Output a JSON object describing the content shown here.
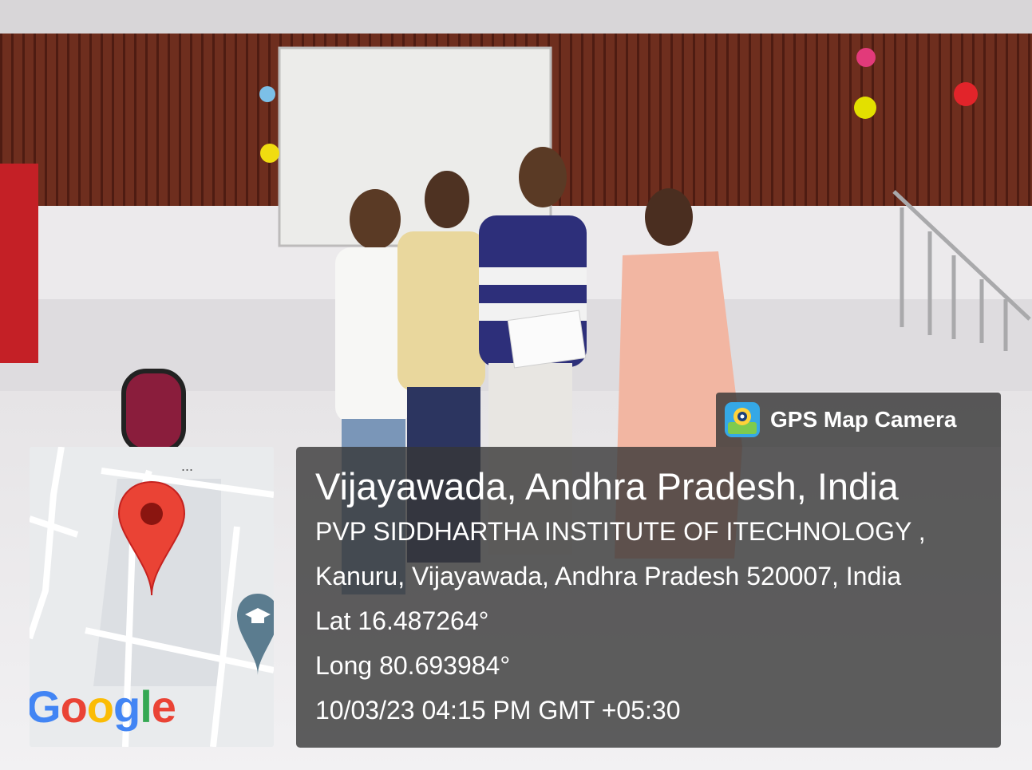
{
  "overlay": {
    "app_label": "GPS Map Camera",
    "app_icon": "gps-map-camera-icon",
    "location_title": "Vijayawada, Andhra Pradesh, India",
    "address_line_1": "PVP SIDDHARTHA INSTITUTE OF ITECHNOLOGY ,",
    "address_line_2": "Kanuru, Vijayawada, Andhra Pradesh 520007, India",
    "latitude": "Lat 16.487264°",
    "longitude": "Long 80.693984°",
    "timestamp": "10/03/23 04:15 PM GMT +05:30"
  },
  "map": {
    "provider_logo": "Google",
    "marker_icon": "location-pin-icon",
    "poi_icon": "graduation-cap-icon",
    "marker_color": "#ea4335",
    "panel_color": "#373737"
  },
  "photo": {
    "scene": "certificate-presentation"
  }
}
